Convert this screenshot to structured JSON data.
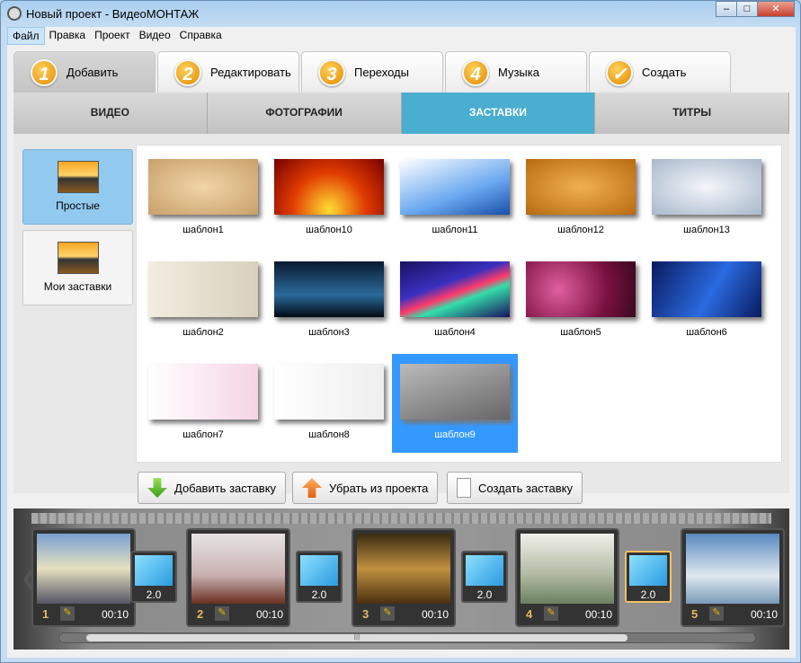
{
  "window": {
    "title": "Новый проект - ВидеоМОНТАЖ",
    "controls": [
      "‒",
      "□",
      "✕"
    ]
  },
  "menu": [
    "Файл",
    "Правка",
    "Проект",
    "Видео",
    "Справка"
  ],
  "steps": [
    {
      "num": "1",
      "label": "Добавить"
    },
    {
      "num": "2",
      "label": "Редактировать"
    },
    {
      "num": "3",
      "label": "Переходы"
    },
    {
      "num": "4",
      "label": "Музыка"
    },
    {
      "num": "✓",
      "label": "Создать"
    }
  ],
  "subtabs": [
    "ВИДЕО",
    "ФОТОГРАФИИ",
    "ЗАСТАВКИ",
    "ТИТРЫ"
  ],
  "active_subtab": "ЗАСТАВКИ",
  "categories": [
    {
      "label": "Простые"
    },
    {
      "label": "Мои заставки"
    }
  ],
  "templates": [
    {
      "label": "шаблон1",
      "bg": "radial-gradient(#f0d5a8,#c9a06a)"
    },
    {
      "label": "шаблон10",
      "bg": "radial-gradient(circle at 50% 90%,#ffdd33,#e03a00 50%,#700 100%)"
    },
    {
      "label": "шаблон11",
      "bg": "linear-gradient(160deg,#fff,#6aa8f0 60%,#1a4fa8)"
    },
    {
      "label": "шаблон12",
      "bg": "radial-gradient(#f0b050,#b86a10)"
    },
    {
      "label": "шаблон13",
      "bg": "radial-gradient(#f4f6fa,#a8b8cc)"
    },
    {
      "label": "шаблон2",
      "bg": "linear-gradient(90deg,#f2ede0,#d8d0bc)"
    },
    {
      "label": "шаблон3",
      "bg": "linear-gradient(#0a1a30,#2a6a9a 60%,#020a14)"
    },
    {
      "label": "шаблон4",
      "bg": "linear-gradient(160deg,#1a1060,#3a30c0 40%,#ff3a6a 55%,#33ddaa 65%,#1a1060)"
    },
    {
      "label": "шаблон5",
      "bg": "radial-gradient(circle at 30% 50%,#e060a0,#7a1040 60%,#3a0820)"
    },
    {
      "label": "шаблон6",
      "bg": "linear-gradient(120deg,#0a1a60,#2a6ae0 55%,#0a1a60)"
    },
    {
      "label": "шаблон7",
      "bg": "linear-gradient(90deg,#fff,#f6d4e4)"
    },
    {
      "label": "шаблон8",
      "bg": "linear-gradient(90deg,#fff,#eee)"
    },
    {
      "label": "шаблон9",
      "bg": "linear-gradient(160deg,#bbb,#666)"
    }
  ],
  "selected_template": "шаблон9",
  "actions": [
    {
      "label": "Добавить заставку",
      "icon": "arrow-down-icon"
    },
    {
      "label": "Убрать из проекта",
      "icon": "arrow-up-icon"
    },
    {
      "label": "Создать заставку",
      "icon": "document-icon"
    }
  ],
  "timeline": {
    "clips": [
      {
        "n": "1",
        "time": "00:10",
        "bg": "linear-gradient(#7aa0d0,#e6e0c0 50%,#556)"
      },
      {
        "n": "2",
        "time": "00:10",
        "bg": "linear-gradient(#e8e4e4,#c8b0b0 60%,#6a3020)"
      },
      {
        "n": "3",
        "time": "00:10",
        "bg": "linear-gradient(#3a2a10,#c09040 50%,#4a3010)"
      },
      {
        "n": "4",
        "time": "00:10",
        "bg": "linear-gradient(#f0f0ea,#b0b8a0 60%,#6a8060)"
      },
      {
        "n": "5",
        "time": "00:10",
        "bg": "linear-gradient(#5a8ac0,#dfe8f0 60%,#7a9ab8)"
      }
    ],
    "transitions": [
      "2.0",
      "2.0",
      "2.0",
      "2.0"
    ],
    "selected_transition": 4
  }
}
